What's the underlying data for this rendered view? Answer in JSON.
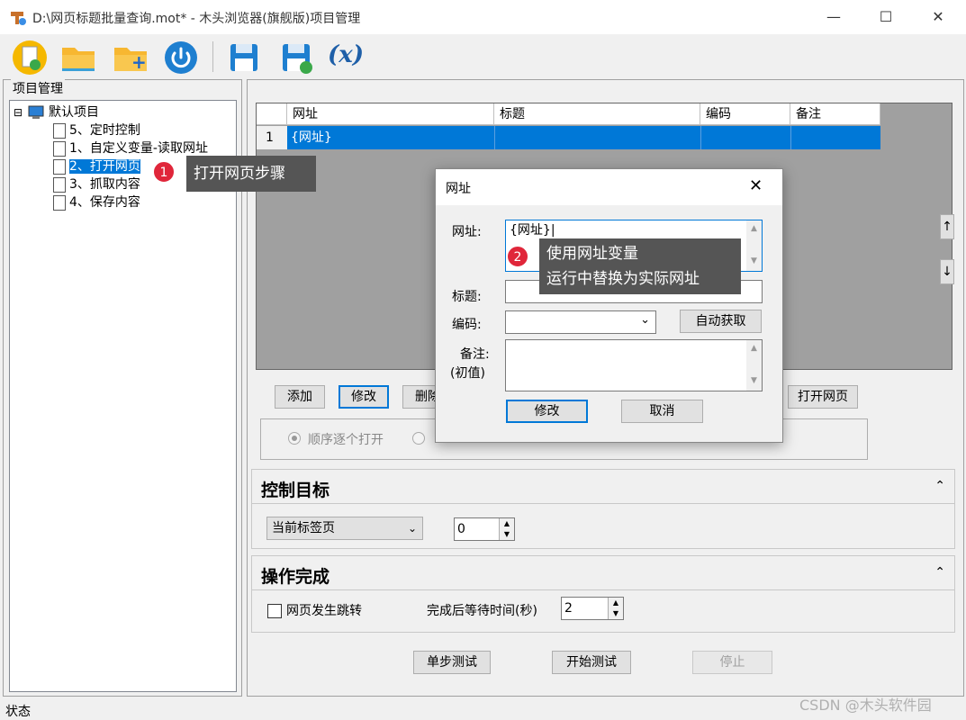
{
  "window": {
    "title": "D:\\网页标题批量查询.mot* - 木头浏览器(旗舰版)项目管理",
    "minimize": "—",
    "maximize": "☐",
    "close": "✕"
  },
  "toolbar": {
    "variable_label": "(x)"
  },
  "left": {
    "header": "项目管理",
    "tree": {
      "expander": "⊟",
      "root": "默认项目",
      "items": [
        "5、定时控制",
        "1、自定义变量-读取网址",
        "2、打开网页",
        "3、抓取内容",
        "4、保存内容"
      ]
    }
  },
  "grid": {
    "columns": [
      "网址",
      "标题",
      "编码",
      "备注"
    ],
    "rows": [
      {
        "num": "1",
        "url": "{网址}",
        "title": "",
        "encoding": "",
        "note": ""
      }
    ],
    "up_arrow": "↑",
    "down_arrow": "↓"
  },
  "actions": {
    "add": "添加",
    "modify": "修改",
    "delete": "删除",
    "open_page": "打开网页"
  },
  "open_mode": {
    "option1": "顺序逐个打开"
  },
  "control_target": {
    "title": "控制目标",
    "tab_select": "当前标签页",
    "number": "0"
  },
  "operation_done": {
    "title": "操作完成",
    "page_jump": "网页发生跳转",
    "wait_label": "完成后等待时间(秒)",
    "wait_value": "2"
  },
  "bottom": {
    "step_test": "单步测试",
    "start_test": "开始测试",
    "stop": "停止"
  },
  "status": {
    "text": "状态"
  },
  "dialog": {
    "title": "网址",
    "close": "✕",
    "url_label": "网址:",
    "url_value": "{网址}|",
    "title_label": "标题:",
    "encoding_label": "编码:",
    "auto_fetch": "自动获取",
    "note_label": "备注:",
    "note_sub": "(初值)",
    "modify": "修改",
    "cancel": "取消"
  },
  "annotations": {
    "badge1": "1",
    "tip1": "打开网页步骤",
    "badge2": "2",
    "tip2_line1": "使用网址变量",
    "tip2_line2": "运行中替换为实际网址"
  },
  "watermark": "CSDN @木头软件园",
  "colors": {
    "selection": "#0078d7",
    "badge": "#e0263a",
    "tooltip": "#555555"
  }
}
